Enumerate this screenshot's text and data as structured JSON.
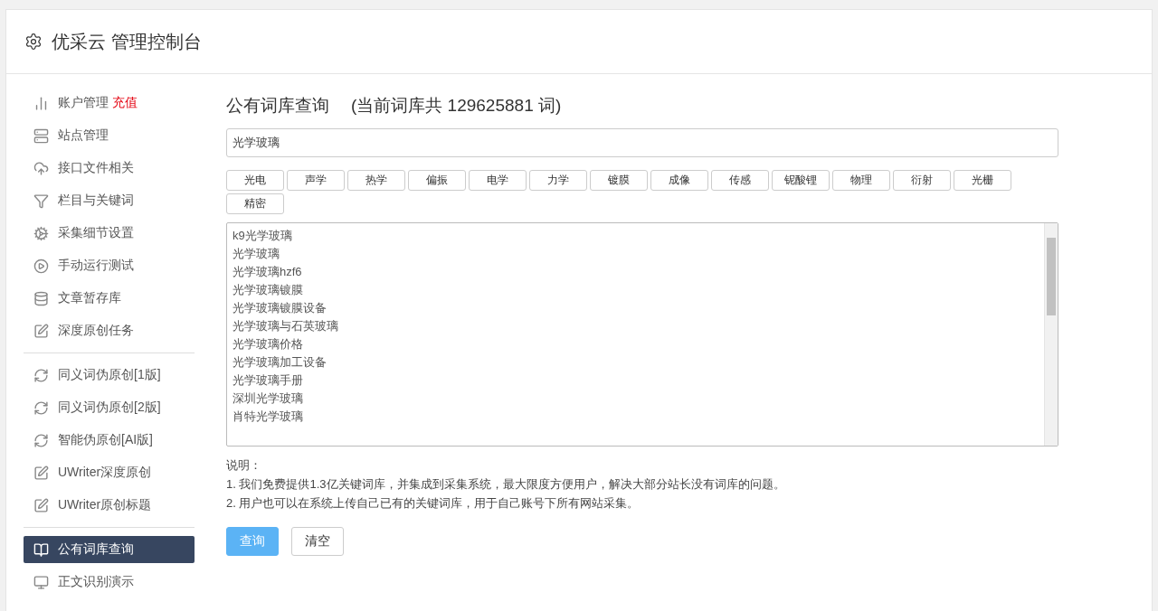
{
  "header": {
    "title": "优采云 管理控制台"
  },
  "sidebar": {
    "groups": [
      [
        {
          "kind": "chart",
          "label": "账户管理",
          "badge": "充值",
          "selected": false
        },
        {
          "kind": "server",
          "label": "站点管理",
          "selected": false
        },
        {
          "kind": "cloud",
          "label": "接口文件相关",
          "selected": false
        },
        {
          "kind": "filter",
          "label": "栏目与关键词",
          "selected": false
        },
        {
          "kind": "gears",
          "label": "采集细节设置",
          "selected": false
        },
        {
          "kind": "play",
          "label": "手动运行测试",
          "selected": false
        },
        {
          "kind": "database",
          "label": "文章暂存库",
          "selected": false
        },
        {
          "kind": "edit",
          "label": "深度原创任务",
          "selected": false
        }
      ],
      [
        {
          "kind": "refresh",
          "label": "同义词伪原创[1版]",
          "selected": false
        },
        {
          "kind": "refresh",
          "label": "同义词伪原创[2版]",
          "selected": false
        },
        {
          "kind": "refresh",
          "label": "智能伪原创[AI版]",
          "selected": false
        },
        {
          "kind": "edit",
          "label": "UWriter深度原创",
          "selected": false
        },
        {
          "kind": "edit",
          "label": "UWriter原创标题",
          "selected": false
        }
      ],
      [
        {
          "kind": "book",
          "label": "公有词库查询",
          "selected": true
        },
        {
          "kind": "monitor",
          "label": "正文识别演示",
          "selected": false
        }
      ]
    ]
  },
  "main": {
    "title": "公有词库查询",
    "count": "(当前词库共 129625881 词)",
    "search": {
      "value": "光学玻璃"
    },
    "tags": [
      "光电",
      "声学",
      "热学",
      "偏振",
      "电学",
      "力学",
      "镀膜",
      "成像",
      "传感",
      "铌酸锂",
      "物理",
      "衍射",
      "光栅",
      "精密"
    ],
    "results": [
      "k9光学玻璃",
      "光学玻璃",
      "光学玻璃hzf6",
      "光学玻璃镀膜",
      "光学玻璃镀膜设备",
      "光学玻璃与石英玻璃",
      "光学玻璃价格",
      "光学玻璃加工设备",
      "光学玻璃手册",
      "深圳光学玻璃",
      "肖特光学玻璃"
    ],
    "notes_title": "说明：",
    "notes": [
      "1. 我们免费提供1.3亿关键词库，并集成到采集系统，最大限度方便用户，解决大部分站长没有词库的问题。",
      "2. 用户也可以在系统上传自己已有的关键词库，用于自己账号下所有网站采集。"
    ],
    "buttons": [
      {
        "label": "查询",
        "kind": "primary"
      },
      {
        "label": "清空",
        "kind": "default"
      }
    ]
  }
}
